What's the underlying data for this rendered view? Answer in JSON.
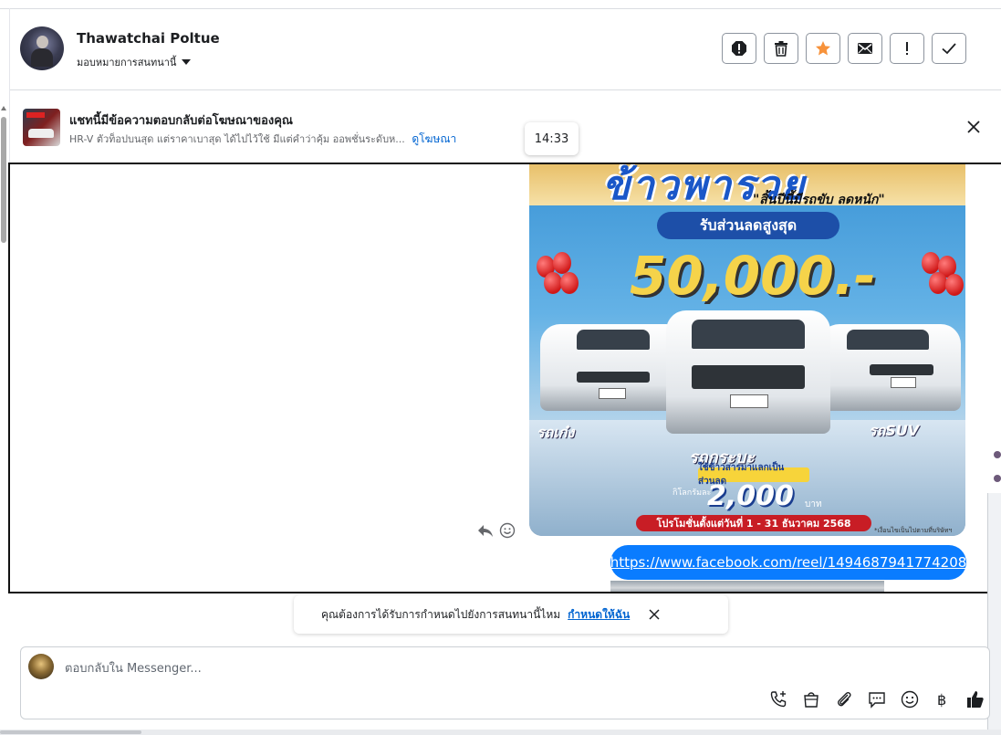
{
  "header": {
    "contact_name": "Thawatchai Poltue",
    "assign_label": "มอบหมายการสนทนานี้",
    "actions": [
      {
        "name": "report-spam-icon"
      },
      {
        "name": "trash-icon"
      },
      {
        "name": "star-icon",
        "color": "#f7923b"
      },
      {
        "name": "envelope-icon"
      },
      {
        "name": "exclamation-icon"
      },
      {
        "name": "checkmark-icon"
      }
    ]
  },
  "ad_context": {
    "title": "แชทนี้มีข้อความตอบกลับต่อโฆษณาของคุณ",
    "subtitle": "HR-V ตัวท็อปบนสุด แต่ราคาเบาสุด ได้ไปไว้ใช้ มีแต่คำว่าคุ้ม ออพชั่นระดับห...",
    "view_ad_link": "ดูโฆษณา"
  },
  "timestamp": "14:33",
  "conversation": {
    "promo_image": {
      "headline": "ข้าวพารวย",
      "tagline": "\"สิ้นปีนี้มีรถขับ ลดหนัก\"",
      "discount_label": "รับส่วนลดสูงสุด",
      "discount_amount": "50,000.-",
      "label_sedan": "รถเก๋ง",
      "label_suv": "รถSUV",
      "label_pickup": "รถกระบะ",
      "rice_trade": "ใช้ข้าวสารมาแลกเป็นส่วนลด",
      "per_kg": "กิโลกรัมละ",
      "per_kg_value": "2,000",
      "per_kg_unit": "บาท",
      "promo_period": "โปรโมชั่นตั้งแต่วันที่ 1 - 31 ธันวาคม 2568",
      "fine_print": "*เงื่อนไขเป็นไปตามที่บริษัทฯ กำหนด"
    },
    "link_message": "https://www.facebook.com/reel/1494687941774208"
  },
  "assign_prompt": {
    "text": "คุณต้องการได้รับการกำหนดไปยังการสนทนานี้ไหม",
    "action": "กำหนดให้ฉัน"
  },
  "composer": {
    "placeholder": "ตอบกลับใน Messenger...",
    "tools": [
      "phone-plus-icon",
      "shopping-bag-icon",
      "paperclip-icon",
      "saved-reply-icon",
      "emoji-icon",
      "baht-icon",
      "thumbs-up-icon"
    ]
  },
  "colors": {
    "accent_blue": "#0a7cff",
    "link_blue": "#0064d1",
    "star_orange": "#f7923b"
  }
}
